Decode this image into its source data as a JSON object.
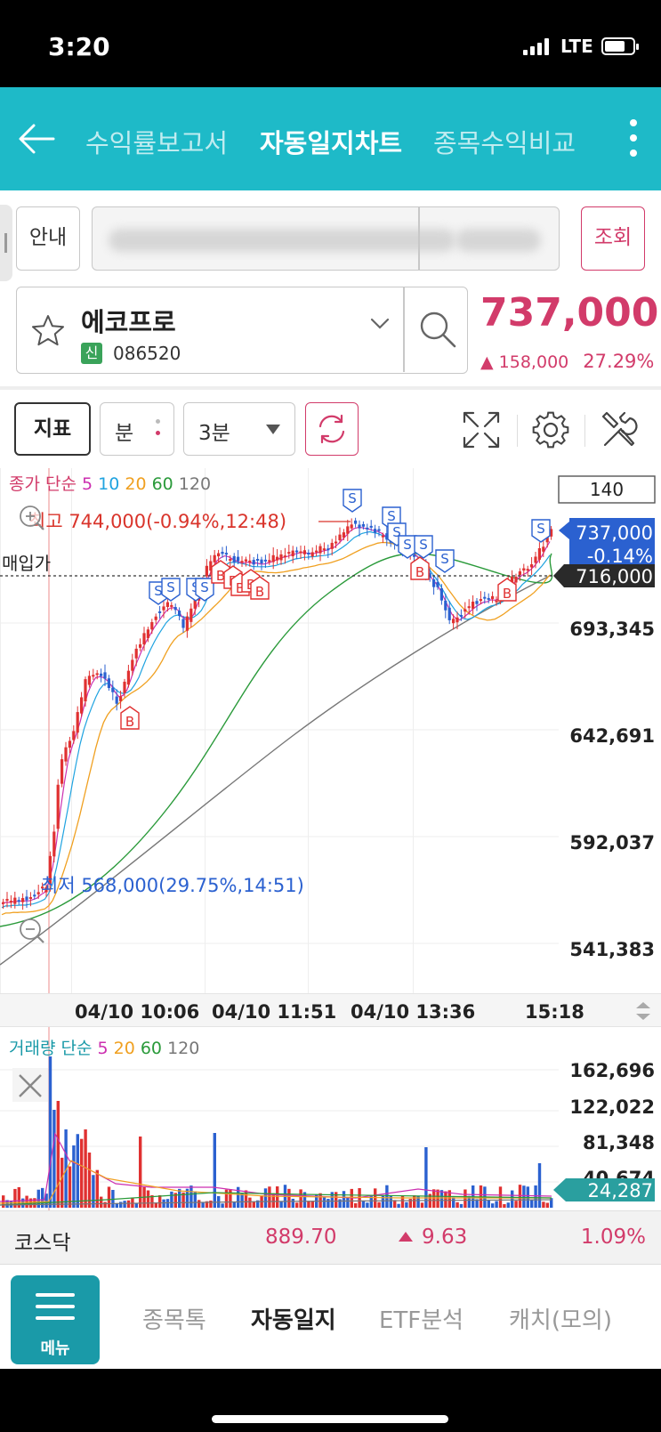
{
  "status": {
    "time": "3:20",
    "network": "LTE"
  },
  "nav": {
    "tabs": [
      {
        "label": "수익률보고서",
        "active": false
      },
      {
        "label": "자동일지차트",
        "active": true
      },
      {
        "label": "종목수익비교",
        "active": false
      }
    ]
  },
  "controls": {
    "guide_label": "안내",
    "query_label": "조회"
  },
  "stock": {
    "name": "에코프로",
    "market_badge": "신",
    "code": "086520",
    "price": "737,000",
    "change": "158,000",
    "change_pct": "27.29%"
  },
  "toolbar": {
    "indicator_label": "지표",
    "unit_label": "분",
    "interval_label": "3분"
  },
  "chart_data": [
    {
      "type": "candlestick",
      "indicator_legend": {
        "prefix": "종가 단순",
        "periods": [
          "5",
          "10",
          "20",
          "60",
          "120"
        ],
        "colors": [
          "#cc2fb0",
          "#1fa3e0",
          "#f0a020",
          "#2a9a3a",
          "#777777"
        ]
      },
      "visible_count": "140",
      "y_ticks": [
        "693,345",
        "642,691",
        "592,037",
        "541,383"
      ],
      "x_ticks": [
        "04/10 10:06",
        "04/10 11:51",
        "04/10 13:36",
        "15:18"
      ],
      "high_label": "최고 744,000(-0.94%,12:48)",
      "low_label": "최저 568,000(29.75%,14:51)",
      "buy_price_label": "매입가",
      "buy_price": "716,000",
      "current_price": "737,000",
      "current_change": "-0.14%",
      "sell_marker": "S",
      "buy_marker": "B",
      "colors": {
        "up": "#e03131",
        "down": "#2b61d0"
      }
    },
    {
      "type": "bar",
      "legend": {
        "prefix": "거래량 단순",
        "periods": [
          "5",
          "20",
          "60",
          "120"
        ],
        "colors": [
          "#cc2fb0",
          "#f0a020",
          "#2a9a3a",
          "#777777"
        ]
      },
      "y_ticks": [
        "162,696",
        "122,022",
        "81,348",
        "40,674"
      ],
      "current_value": "24,287"
    }
  ],
  "market_index": {
    "name": "코스닥",
    "value": "889.70",
    "change": "9.63",
    "change_pct": "1.09%"
  },
  "bottom_nav": {
    "menu_label": "메뉴",
    "items": [
      {
        "label": "종목톡",
        "active": false
      },
      {
        "label": "자동일지",
        "active": true
      },
      {
        "label": "ETF분석",
        "active": false
      },
      {
        "label": "캐치(모의)",
        "active": false
      }
    ]
  },
  "theme": {
    "primary": "#1ebac8",
    "accent": "#d23b6a",
    "down": "#2b61d0"
  }
}
